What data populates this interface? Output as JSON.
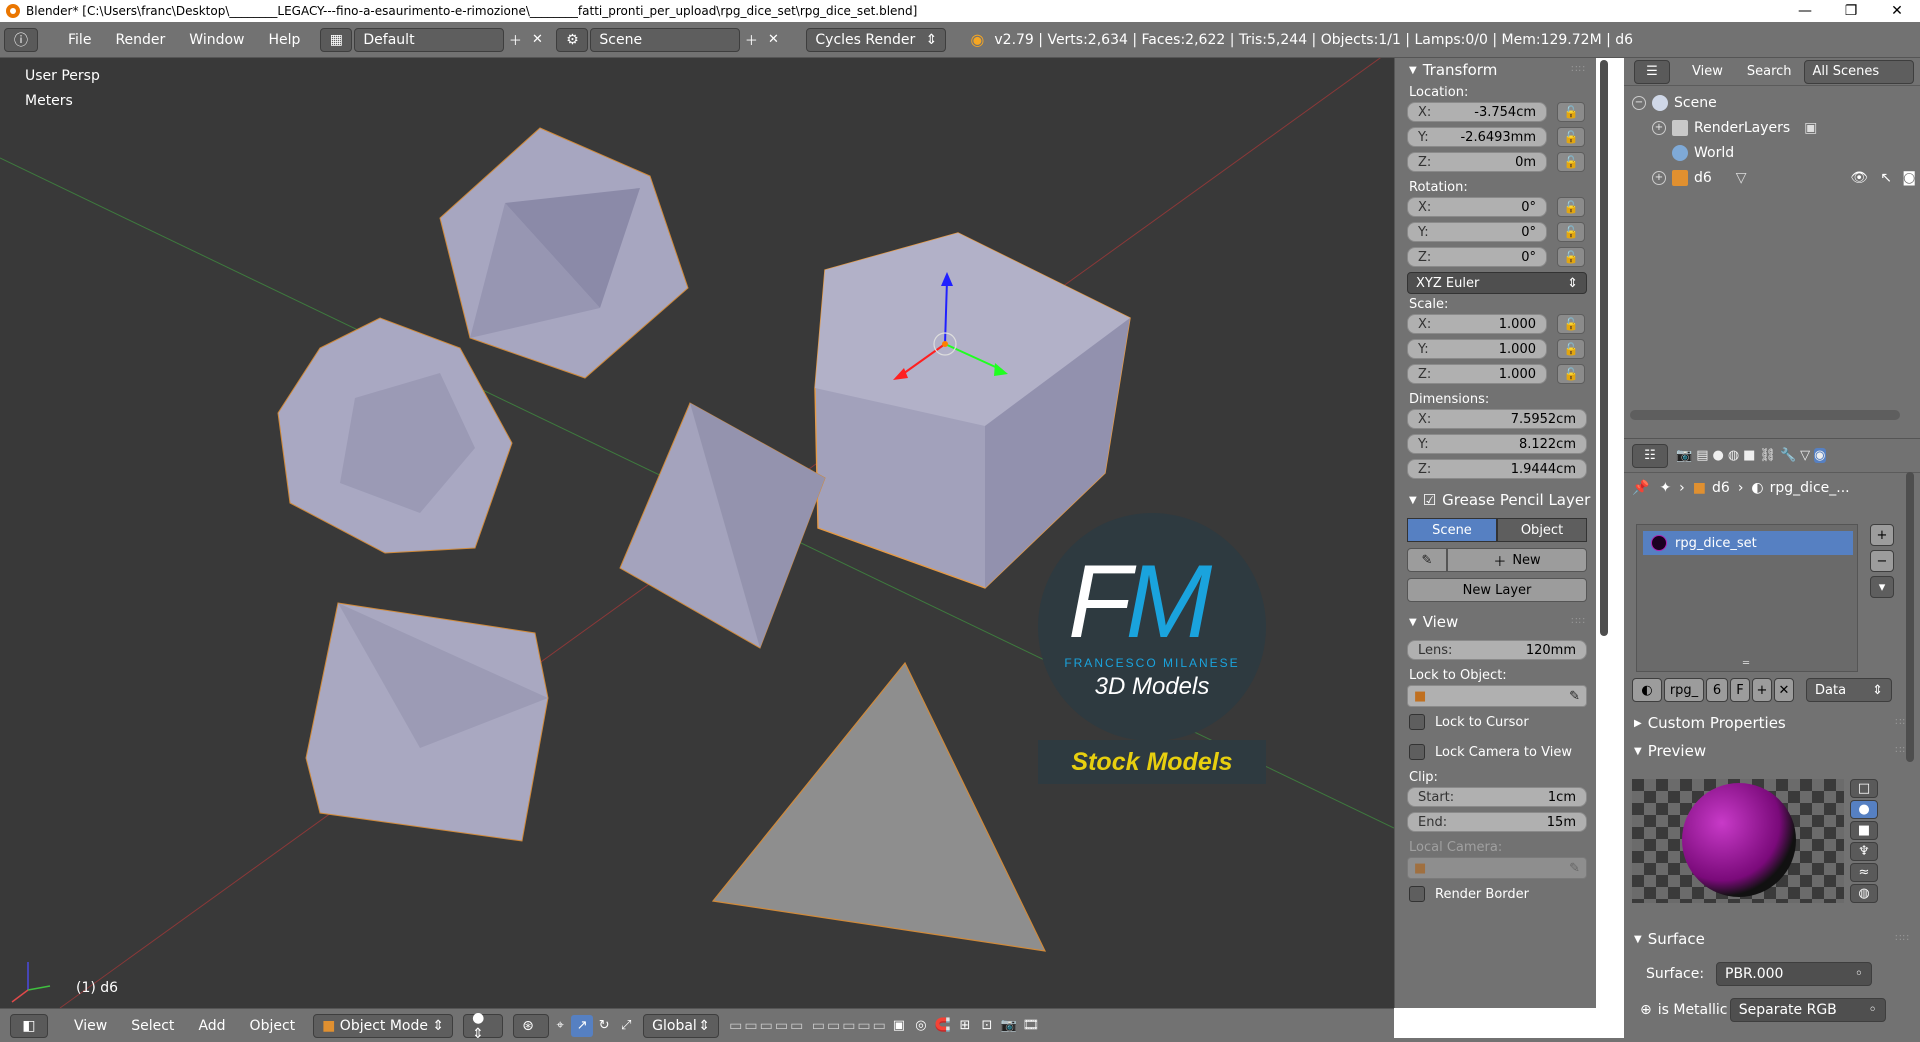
{
  "window": {
    "title": "Blender* [C:\\Users\\franc\\Desktop\\________LEGACY---fino-a-esaurimento-e-rimozione\\________fatti_pronti_per_upload\\rpg_dice_set\\rpg_dice_set.blend]",
    "controls": [
      "—",
      "❐",
      "✕"
    ]
  },
  "header": {
    "menus": [
      "File",
      "Render",
      "Window",
      "Help"
    ],
    "layout": "Default",
    "scene": "Scene",
    "engine": "Cycles Render",
    "stats": "v2.79 | Verts:2,634 | Faces:2,622 | Tris:5,244 | Objects:1/1 | Lamps:0/0 | Mem:129.72M | d6"
  },
  "viewport": {
    "persp": "User Persp",
    "units": "Meters",
    "object": "(1) d6",
    "watermark": {
      "f": "F",
      "m": "M",
      "author": "FRANCESCO MILANESE",
      "tagline": "3D Models",
      "stock": "Stock Models"
    }
  },
  "npanel": {
    "transform": {
      "title": "Transform",
      "location_label": "Location:",
      "location": [
        {
          "axis": "X:",
          "value": "-3.754cm"
        },
        {
          "axis": "Y:",
          "value": "-2.6493mm"
        },
        {
          "axis": "Z:",
          "value": "0m"
        }
      ],
      "rotation_label": "Rotation:",
      "rotation": [
        {
          "axis": "X:",
          "value": "0°"
        },
        {
          "axis": "Y:",
          "value": "0°"
        },
        {
          "axis": "Z:",
          "value": "0°"
        }
      ],
      "rotation_mode": "XYZ Euler",
      "scale_label": "Scale:",
      "scale": [
        {
          "axis": "X:",
          "value": "1.000"
        },
        {
          "axis": "Y:",
          "value": "1.000"
        },
        {
          "axis": "Z:",
          "value": "1.000"
        }
      ],
      "dimensions_label": "Dimensions:",
      "dimensions": [
        {
          "axis": "X:",
          "value": "7.5952cm"
        },
        {
          "axis": "Y:",
          "value": "8.122cm"
        },
        {
          "axis": "Z:",
          "value": "1.9444cm"
        }
      ]
    },
    "grease": {
      "title": "Grease Pencil Layer",
      "scene": "Scene",
      "object": "Object",
      "new": "New",
      "new_layer": "New Layer"
    },
    "view": {
      "title": "View",
      "lens_label": "Lens:",
      "lens": "120mm",
      "lock_to_object": "Lock to Object:",
      "lock_to_cursor": "Lock to Cursor",
      "lock_camera": "Lock Camera to View",
      "clip": "Clip:",
      "start_label": "Start:",
      "start": "1cm",
      "end_label": "End:",
      "end": "15m",
      "local_camera": "Local Camera:",
      "render_border": "Render Border"
    }
  },
  "outliner": {
    "view": "View",
    "search": "Search",
    "filter": "All Scenes",
    "items": [
      "Scene",
      "RenderLayers",
      "World",
      "d6"
    ]
  },
  "properties": {
    "crumb_object": "d6",
    "crumb_material": "rpg_dice_...",
    "material": "rpg_dice_set",
    "mat_short": "rpg_",
    "users": "6",
    "fake": "F",
    "link": "Data",
    "custom_props": "Custom Properties",
    "preview": "Preview",
    "surface": "Surface",
    "surface_label": "Surface:",
    "surface_value": "PBR.000",
    "metallic_label": "is Metallic",
    "metallic_value": "Separate RGB"
  },
  "statusbar": {
    "menus": [
      "View",
      "Select",
      "Add",
      "Object"
    ],
    "mode": "Object Mode",
    "orientation": "Global"
  }
}
